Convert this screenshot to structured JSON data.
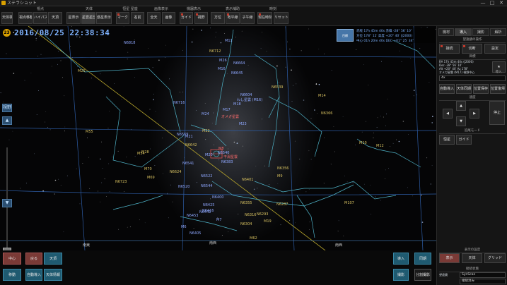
{
  "window": {
    "title": "ステラショット",
    "controls": [
      "—",
      "□",
      "✕"
    ]
  },
  "toolbar": {
    "first": {
      "label": "天体検索"
    },
    "groups": [
      {
        "label": "視点",
        "buttons": [
          "視点移動",
          "ハイパス",
          "天頂"
        ]
      },
      {
        "label": "天体",
        "buttons": [
          "星表示",
          "星雲星団",
          "惑星表示"
        ]
      },
      {
        "label": "恒星 星座",
        "buttons": [
          "マーク",
          "名前"
        ]
      },
      {
        "label": "画像表示",
        "buttons": [
          "全天",
          "画像"
        ]
      },
      {
        "label": "機器表示",
        "buttons": [
          "ガイド",
          "視野"
        ]
      },
      {
        "label": "表示補助",
        "buttons": [
          "方位",
          "地平線",
          "子午線"
        ]
      },
      {
        "label": "時刻",
        "buttons": [
          "現在時刻",
          "リセット"
        ]
      }
    ]
  },
  "sky": {
    "badge": "23",
    "datetime": "2016/08/25   22:38:34",
    "info_thumb": "目標",
    "info_lines": [
      "赤経 17h 45m 40s  赤緯 -28° 56′ 10″",
      "方位 178° 12′  高度 +20° 40′  (J2000)",
      "中心 01h 20m 40s  DEC +01° 25′ 34″"
    ],
    "directions": {
      "left": "南東",
      "center": "南西",
      "right": "南西"
    },
    "objects": [
      {
        "name": "M25",
        "c": "y"
      },
      {
        "name": "N6818",
        "c": "b"
      },
      {
        "name": "M11",
        "c": "b"
      },
      {
        "name": "N6712",
        "c": "y"
      },
      {
        "name": "M26",
        "c": "b"
      },
      {
        "name": "N6664",
        "c": "b"
      },
      {
        "name": "M16",
        "c": "b"
      },
      {
        "name": "N6645",
        "c": "b"
      },
      {
        "name": "N6604",
        "c": "b"
      },
      {
        "name": "わし星雲 (M16)",
        "c": "b"
      },
      {
        "name": "M18",
        "c": "b"
      },
      {
        "name": "N6539",
        "c": "y"
      },
      {
        "name": "M14",
        "c": "y"
      },
      {
        "name": "N6366",
        "c": "y"
      },
      {
        "name": "M17",
        "c": "b"
      },
      {
        "name": "オメガ星雲",
        "c": "r"
      },
      {
        "name": "N6716",
        "c": "b"
      },
      {
        "name": "M24",
        "c": "b"
      },
      {
        "name": "M23",
        "c": "b"
      },
      {
        "name": "M55",
        "c": "y"
      },
      {
        "name": "N6569",
        "c": "b"
      },
      {
        "name": "M21",
        "c": "b"
      },
      {
        "name": "M22",
        "c": "y"
      },
      {
        "name": "N6642",
        "c": "y"
      },
      {
        "name": "M28",
        "c": "y"
      },
      {
        "name": "M8",
        "c": "r"
      },
      {
        "name": "干潟星雲",
        "c": "r"
      },
      {
        "name": "M54",
        "c": "y"
      },
      {
        "name": "M70",
        "c": "y"
      },
      {
        "name": "N6624",
        "c": "y"
      },
      {
        "name": "M69",
        "c": "y"
      },
      {
        "name": "N6723",
        "c": "y"
      },
      {
        "name": "N6522",
        "c": "b"
      },
      {
        "name": "N6520",
        "c": "b"
      },
      {
        "name": "N6401",
        "c": "y"
      },
      {
        "name": "N6356",
        "c": "y"
      },
      {
        "name": "M9",
        "c": "y"
      },
      {
        "name": "N6540",
        "c": "b"
      },
      {
        "name": "M10",
        "c": "y"
      },
      {
        "name": "M12",
        "c": "y"
      },
      {
        "name": "N6441",
        "c": "b"
      },
      {
        "name": "N6425",
        "c": "b"
      },
      {
        "name": "N6416",
        "c": "b"
      },
      {
        "name": "N6453",
        "c": "b"
      },
      {
        "name": "N6316",
        "c": "y"
      },
      {
        "name": "N6293",
        "c": "y"
      },
      {
        "name": "N6287",
        "c": "y"
      },
      {
        "name": "M19",
        "c": "y"
      },
      {
        "name": "N6304",
        "c": "y"
      },
      {
        "name": "M107",
        "c": "y"
      },
      {
        "name": "M62",
        "c": "y"
      },
      {
        "name": "M6",
        "c": "b"
      },
      {
        "name": "M7",
        "c": "b"
      },
      {
        "name": "N6405",
        "c": "b"
      },
      {
        "name": "N6355",
        "c": "y"
      },
      {
        "name": "N6541",
        "c": "b"
      },
      {
        "name": "N6400",
        "c": "b"
      },
      {
        "name": "M20",
        "c": "b"
      },
      {
        "name": "N6544",
        "c": "b"
      },
      {
        "name": "N6383",
        "c": "b"
      }
    ]
  },
  "zoom": {
    "plus": "+",
    "minus": "−",
    "fov": "視野",
    "up": "▲",
    "down": "▼"
  },
  "bottom": {
    "left_buttons": [
      "中心",
      "戻る",
      "天頂",
      "移動",
      "自動導入",
      "天体情報"
    ],
    "right_buttons": [
      "導入",
      "同期",
      "撮影",
      "分割撮影"
    ]
  },
  "rpanel": {
    "tabs": [
      "機材",
      "導入",
      "撮影",
      "解析"
    ],
    "section1": "望遠鏡の操作",
    "conn_buttons": [
      "接続",
      "切断",
      "設定"
    ],
    "target_label": "目標",
    "coords": [
      "RA 17h 45m 40s (J2000)",
      "Dec -28° 56′ 10″",
      "Alt +20° 40′  Az 178°",
      "オメガ星雲 (M17) 視野中心"
    ],
    "goto_label": "導入",
    "star_btn": "★",
    "speed_value": "4x",
    "action_buttons": [
      "自動導入",
      "天体同期",
      "位置保存",
      "位置復帰"
    ],
    "pad_label": "速度",
    "pad": {
      "up": "▲",
      "down": "▼",
      "left": "◀",
      "right": "▶",
      "stop": "停止"
    },
    "track_label": "追尾モード",
    "track_buttons": [
      "恒星",
      "ガイド"
    ],
    "section2": "表示の設定",
    "view_buttons": [
      "表示",
      "天体",
      "グリッド"
    ],
    "section3": "接続状態",
    "status_label": "望遠鏡",
    "status_value": "SynScan",
    "status_detail": "接続済み"
  }
}
